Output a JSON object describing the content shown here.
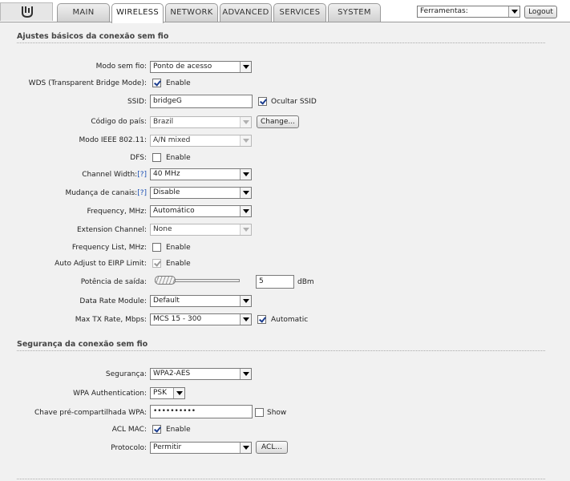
{
  "tabs": [
    {
      "label": "MAIN",
      "active": false
    },
    {
      "label": "WIRELESS",
      "active": true
    },
    {
      "label": "NETWORK",
      "active": false
    },
    {
      "label": "ADVANCED",
      "active": false
    },
    {
      "label": "SERVICES",
      "active": false
    },
    {
      "label": "SYSTEM",
      "active": false
    }
  ],
  "tools": {
    "selected": "Ferramentas:",
    "logout_label": "Logout"
  },
  "basic": {
    "title": "Ajustes básicos da conexão sem fio",
    "wireless_mode": {
      "label": "Modo sem fio:",
      "value": "Ponto de acesso"
    },
    "wds": {
      "label": "WDS (Transparent Bridge Mode):",
      "checked": true,
      "option": "Enable"
    },
    "ssid": {
      "label": "SSID:",
      "value": "bridgeG",
      "hide_label": "Ocultar SSID",
      "hide_checked": true
    },
    "country": {
      "label": "Código do país:",
      "value": "Brazil",
      "change_label": "Change..."
    },
    "ieee_mode": {
      "label": "Modo IEEE 802.11:",
      "value": "A/N mixed"
    },
    "dfs": {
      "label": "DFS:",
      "checked": false,
      "option": "Enable"
    },
    "channel_width": {
      "label": "Channel Width:",
      "help": "[?]",
      "value": "40 MHz"
    },
    "channel_shifting": {
      "label": "Mudança de canais:",
      "help": "[?]",
      "value": "Disable"
    },
    "frequency": {
      "label": "Frequency, MHz:",
      "value": "Automático"
    },
    "extension_channel": {
      "label": "Extension Channel:",
      "value": "None"
    },
    "frequency_list": {
      "label": "Frequency List, MHz:",
      "checked": false,
      "option": "Enable"
    },
    "auto_adjust": {
      "label": "Auto Adjust to EIRP Limit:",
      "checked": true,
      "option": "Enable"
    },
    "output_power": {
      "label": "Potência de saída:",
      "value": "5",
      "unit": "dBm",
      "slider_fraction": 0.0
    },
    "data_rate_module": {
      "label": "Data Rate Module:",
      "value": "Default"
    },
    "max_tx_rate": {
      "label": "Max TX Rate, Mbps:",
      "value": "MCS 15 - 300",
      "auto_label": "Automatic",
      "auto_checked": true
    }
  },
  "security": {
    "title": "Segurança da conexão sem fio",
    "security": {
      "label": "Segurança:",
      "value": "WPA2-AES"
    },
    "wpa_auth": {
      "label": "WPA Authentication:",
      "value": "PSK"
    },
    "psk": {
      "label": "Chave pré-compartilhada WPA:",
      "value": "••••••••••",
      "show_label": "Show",
      "show_checked": false
    },
    "acl_mac": {
      "label": "ACL MAC:",
      "checked": true,
      "option": "Enable"
    },
    "protocol": {
      "label": "Protocolo:",
      "value": "Permitir",
      "acl_label": "ACL..."
    }
  }
}
